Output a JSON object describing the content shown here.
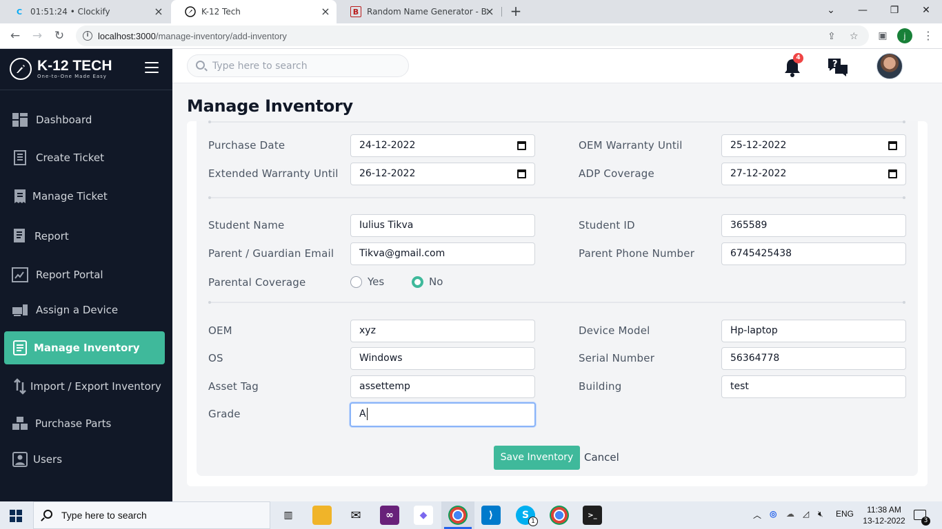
{
  "browser": {
    "tabs": [
      {
        "title": "01:51:24 • Clockify",
        "icon": "clockify-icon",
        "color": "#03a9f4"
      },
      {
        "title": "K-12 Tech",
        "icon": "rocket-icon",
        "color": "#111827"
      },
      {
        "title": "Random Name Generator - Behin",
        "icon": "behind-the-name-icon",
        "color": "#b91c1c"
      }
    ],
    "url_host": "localhost:3000",
    "url_path": "/manage-inventory/add-inventory",
    "profile_initial": "j"
  },
  "app": {
    "brand": "K-12 TECH",
    "tagline": "One-to-One Made Easy",
    "search_placeholder": "Type here to search",
    "notification_count": "4",
    "accent": "#3fb99b",
    "sidebar_bg": "#111827"
  },
  "sidebar": {
    "items": [
      {
        "label": "Dashboard",
        "icon": "dashboard-icon"
      },
      {
        "label": "Create Ticket",
        "icon": "create-ticket-icon"
      },
      {
        "label": "Manage Ticket",
        "icon": "manage-ticket-icon"
      },
      {
        "label": "Report",
        "icon": "report-icon"
      },
      {
        "label": "Report Portal",
        "icon": "report-portal-icon"
      },
      {
        "label": "Assign a Device",
        "icon": "assign-device-icon"
      },
      {
        "label": "Manage Inventory",
        "icon": "manage-inventory-icon",
        "active": true
      },
      {
        "label": "Import / Export Inventory",
        "icon": "import-export-icon"
      },
      {
        "label": "Purchase Parts",
        "icon": "purchase-parts-icon"
      },
      {
        "label": "Users",
        "icon": "users-icon"
      }
    ]
  },
  "page": {
    "title": "Manage Inventory"
  },
  "form": {
    "purchase_date": {
      "label": "Purchase Date",
      "value": "24-12-2022"
    },
    "oem_warranty": {
      "label": "OEM Warranty Until",
      "value": "25-12-2022"
    },
    "extended_warranty": {
      "label": "Extended Warranty Until",
      "value": "26-12-2022"
    },
    "adp_coverage": {
      "label": "ADP Coverage",
      "value": "27-12-2022"
    },
    "student_name": {
      "label": "Student Name",
      "value": "Iulius Tikva"
    },
    "student_id": {
      "label": "Student ID",
      "value": "365589"
    },
    "parent_email": {
      "label": "Parent / Guardian Email",
      "value": "Tikva@gmail.com"
    },
    "parent_phone": {
      "label": "Parent Phone Number",
      "value": "6745425438"
    },
    "parental_coverage": {
      "label": "Parental Coverage",
      "yes": "Yes",
      "no": "No",
      "selected": "No"
    },
    "oem": {
      "label": "OEM",
      "value": "xyz"
    },
    "device_model": {
      "label": "Device Model",
      "value": "Hp-laptop"
    },
    "os": {
      "label": "OS",
      "value": "Windows"
    },
    "serial_number": {
      "label": "Serial Number",
      "value": "56364778"
    },
    "asset_tag": {
      "label": "Asset Tag",
      "value": "assettemp"
    },
    "building": {
      "label": "Building",
      "value": "test"
    },
    "grade": {
      "label": "Grade",
      "value": "A"
    },
    "save_label": "Save Inventory",
    "cancel_label": "Cancel"
  },
  "taskbar": {
    "search_placeholder": "Type here to search",
    "time": "11:38 AM",
    "date": "13-12-2022",
    "language": "ENG",
    "notification_count": "3",
    "skype_badge": "1"
  }
}
